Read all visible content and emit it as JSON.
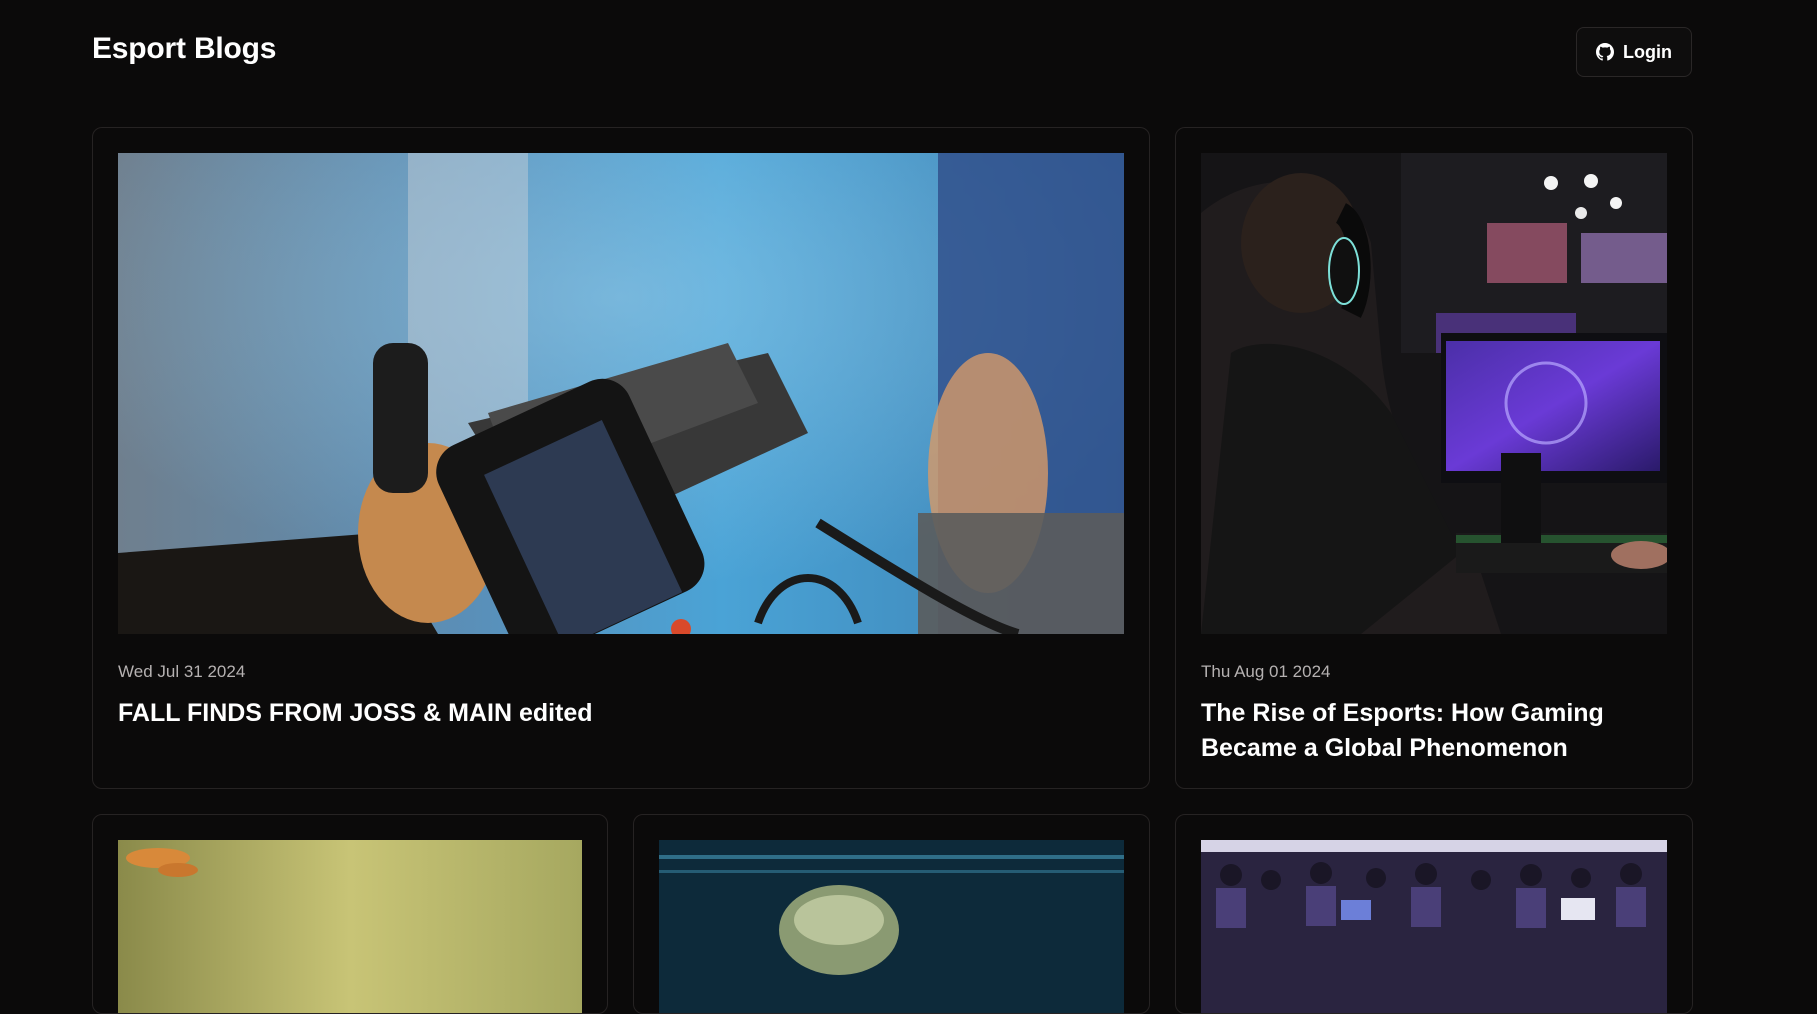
{
  "header": {
    "brand": "Esport Blogs",
    "login_label": "Login",
    "login_icon": "github-icon"
  },
  "posts": [
    {
      "date": "Wed Jul 31 2024",
      "title": "FALL FINDS FROM JOSS & MAIN edited",
      "image": "phone-gimbal-camera-photo"
    },
    {
      "date": "Thu Aug 01 2024",
      "title": "The Rise of Esports: How Gaming Became a Global Phenomenon",
      "image": "gamer-with-headset-photo"
    },
    {
      "image": "sunset-sky-photo"
    },
    {
      "image": "player-portrait-photo"
    },
    {
      "image": "esports-crowd-photo"
    }
  ],
  "colors": {
    "background": "#0b0a0a",
    "card_border": "#262323",
    "text": "#ffffff",
    "muted_text": "#b5b1b1"
  }
}
